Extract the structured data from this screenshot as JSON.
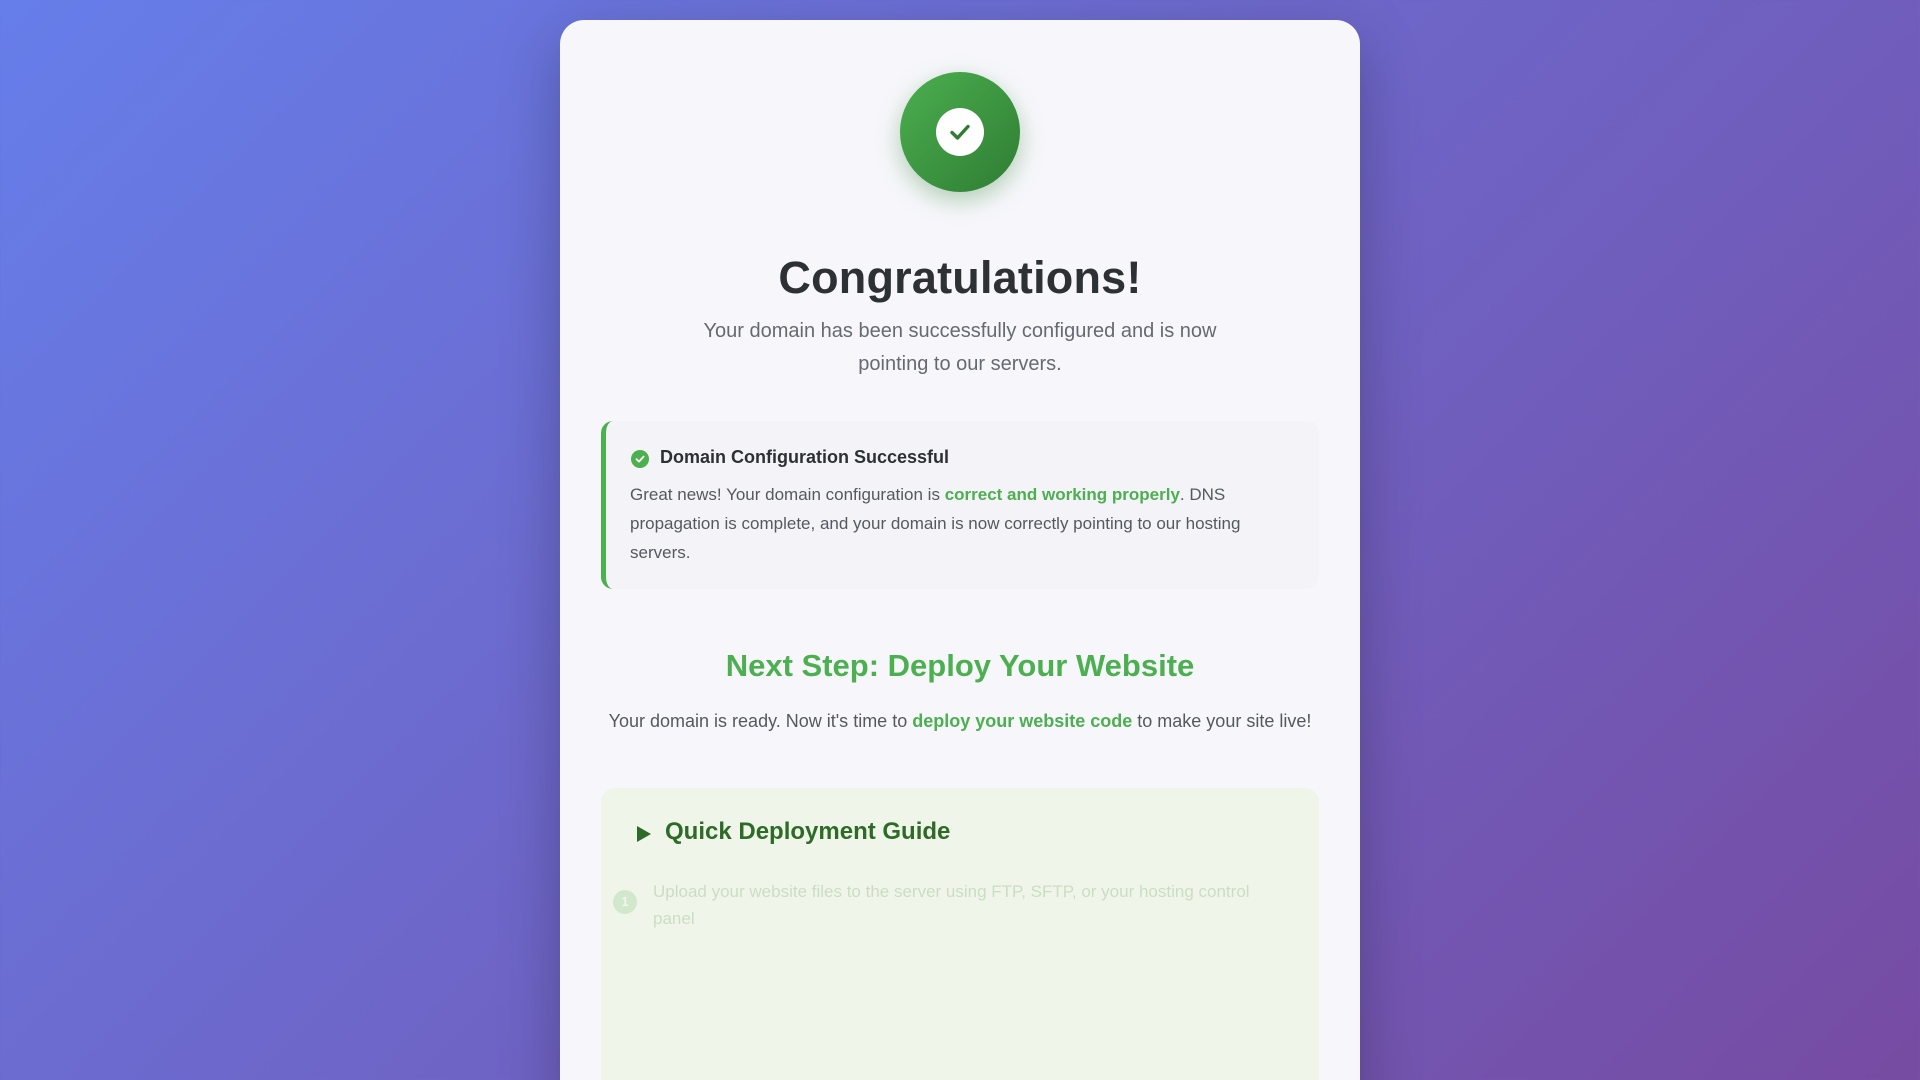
{
  "header": {
    "title": "Congratulations!",
    "subtitle": "Your domain has been successfully configured and is now pointing to our servers."
  },
  "status": {
    "title": "Domain Configuration Successful",
    "text_before": "Great news! Your domain configuration is ",
    "highlight": "correct and working properly",
    "text_after": ". DNS propagation is complete, and your domain is now correctly pointing to our hosting servers."
  },
  "next_step": {
    "title": "Next Step: Deploy Your Website",
    "text_before": "Your domain is ready. Now it's time to ",
    "highlight": "deploy your website code",
    "text_after": " to make your site live!"
  },
  "guide": {
    "title": "Quick Deployment Guide",
    "steps": [
      {
        "number": "1",
        "text": "Upload your website files to the server using FTP, SFTP, or your hosting control panel"
      }
    ]
  },
  "colors": {
    "accent": "#4caf50",
    "accent_dark": "#2e7d32",
    "guide_title": "#2e6b28",
    "background_start": "#667eea",
    "background_end": "#764ba2"
  },
  "icons": {
    "badge": "check-circle-icon",
    "status": "check-circle-icon",
    "guide": "play-icon"
  }
}
